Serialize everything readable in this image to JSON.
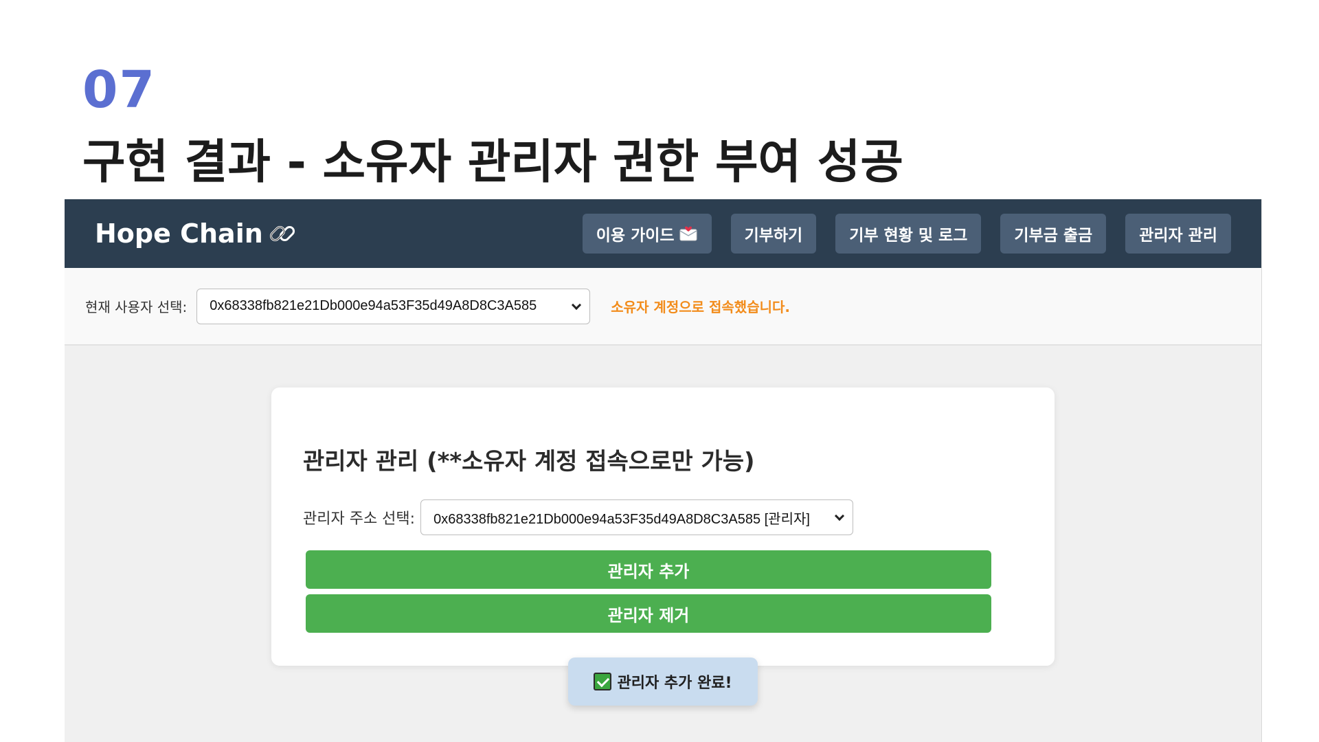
{
  "slide": {
    "number": "07",
    "title": "구현 결과 - 소유자 관리자 권한 부여 성공"
  },
  "navbar": {
    "brand": "Hope Chain",
    "brand_icon": "chain-link-icon",
    "buttons": [
      {
        "label": "이용 가이드",
        "icon": "envelope-icon"
      },
      {
        "label": "기부하기"
      },
      {
        "label": "기부 현황 및 로그"
      },
      {
        "label": "기부금 출금"
      },
      {
        "label": "관리자 관리"
      }
    ]
  },
  "userbar": {
    "label": "현재 사용자 선택:",
    "selected_account": "0x68338fb821e21Db000e94a53F35d49A8D8C3A585",
    "status": "소유자 계정으로 접속했습니다."
  },
  "admin_panel": {
    "title": "관리자 관리 (**소유자 계정 접속으로만 가능)",
    "select_label": "관리자 주소 선택:",
    "selected_admin": "0x68338fb821e21Db000e94a53F35d49A8D8C3A585 [관리자]",
    "add_button": "관리자 추가",
    "remove_button": "관리자 제거"
  },
  "toast": {
    "icon": "check-mark-icon",
    "message": "관리자 추가 완료!"
  },
  "colors": {
    "navbar_bg": "#2c3e50",
    "nav_button_bg": "#4b5f76",
    "green_button": "#4caf50",
    "status_orange": "#f28c1b",
    "slide_number": "#5b6fd1"
  }
}
